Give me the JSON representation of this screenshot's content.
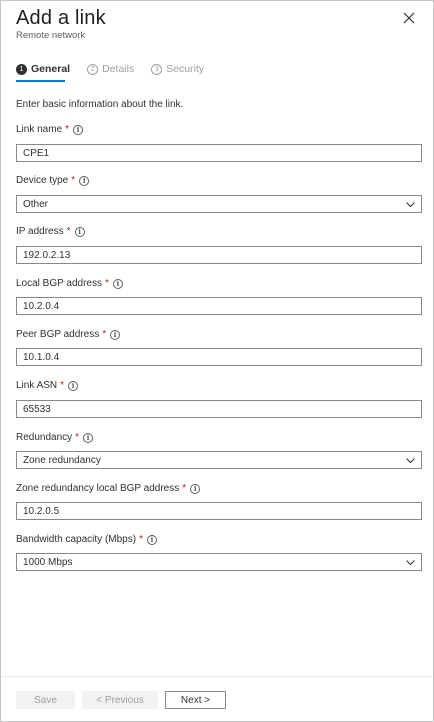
{
  "panel": {
    "title": "Add a link",
    "subtitle": "Remote network",
    "close_icon": "close-icon"
  },
  "tabs": [
    {
      "number": "1",
      "label": "General",
      "active": true
    },
    {
      "number": "2",
      "label": "Details",
      "active": false
    },
    {
      "number": "3",
      "label": "Security",
      "active": false
    }
  ],
  "intro_text": "Enter basic information about the link.",
  "fields": {
    "link_name": {
      "label": "Link name",
      "required": "*",
      "value": "CPE1"
    },
    "device_type": {
      "label": "Device type",
      "required": "*",
      "value": "Other"
    },
    "ip_address": {
      "label": "IP address",
      "required": "*",
      "value": "192.0.2.13"
    },
    "local_bgp": {
      "label": "Local BGP address",
      "required": "*",
      "value": "10.2.0.4"
    },
    "peer_bgp": {
      "label": "Peer BGP address",
      "required": "*",
      "value": "10.1.0.4"
    },
    "link_asn": {
      "label": "Link ASN",
      "required": "*",
      "value": "65533"
    },
    "redundancy": {
      "label": "Redundancy",
      "required": "*",
      "value": "Zone redundancy"
    },
    "zone_local_bgp": {
      "label": "Zone redundancy local BGP address",
      "required": "*",
      "value": "10.2.0.5"
    },
    "bandwidth": {
      "label": "Bandwidth capacity (Mbps)",
      "required": "*",
      "value": "1000 Mbps"
    }
  },
  "info_glyph": "i",
  "footer": {
    "save_label": "Save",
    "previous_label": "< Previous",
    "next_label": "Next >"
  },
  "colors": {
    "accent": "#0078d4",
    "required": "#a4262c",
    "border": "#8a8886"
  }
}
